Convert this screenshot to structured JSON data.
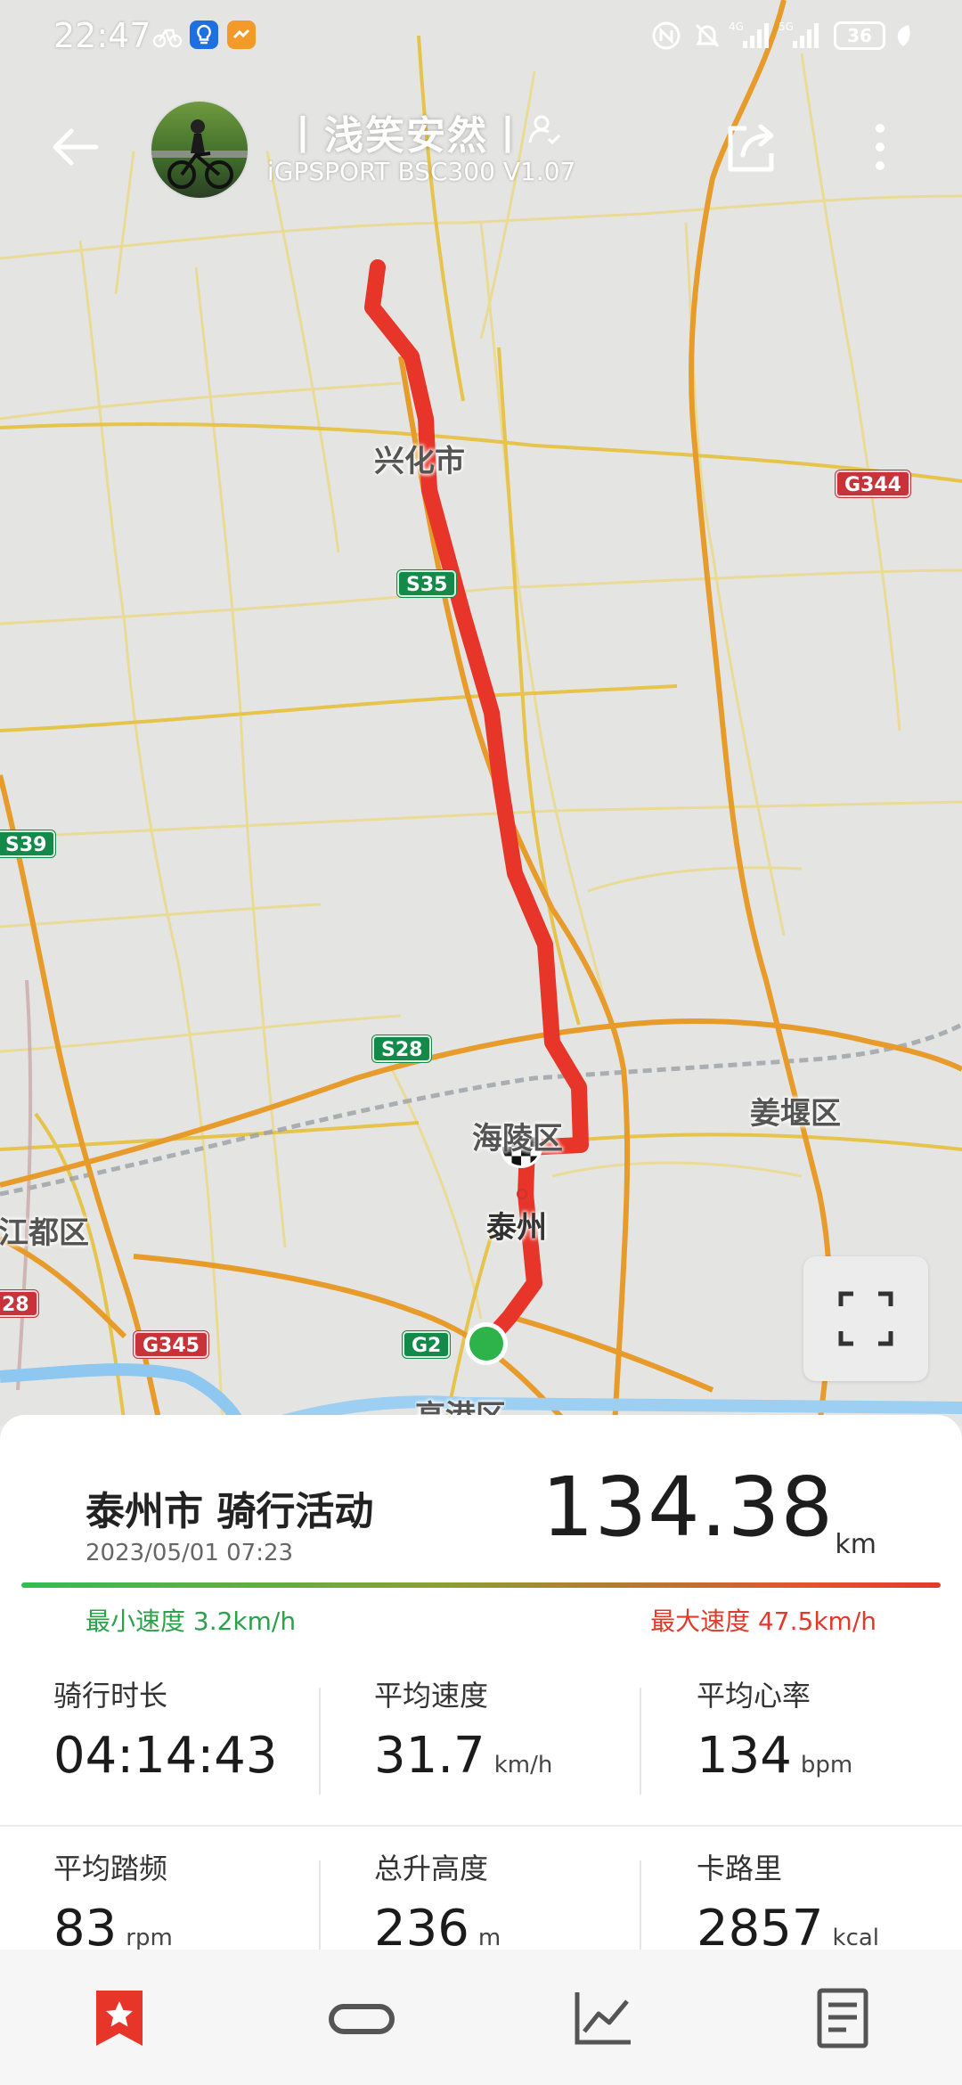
{
  "status_bar": {
    "time": "22:47",
    "battery": "36",
    "icons": [
      "bicycle-notify-icon",
      "lightbulb-app-icon",
      "orange-app-icon",
      "nfc-icon",
      "mute-icon",
      "signal-4g-icon",
      "signal-5g-icon",
      "battery-icon",
      "leaf-icon"
    ]
  },
  "header": {
    "rider_name": "丨浅笑安然丨",
    "device": "iGPSPORT BSC300  V1.07"
  },
  "map": {
    "labels": {
      "xinghua": "兴化市",
      "hailing": "海陵区",
      "taizhou": "泰州",
      "jiangyan": "姜堰区",
      "jiangdu": "江都区",
      "gaogang": "高港区"
    },
    "shields": {
      "s35": "S35",
      "s39": "S39",
      "s28": "S28",
      "g344": "G344",
      "g345": "G345",
      "g2": "G2",
      "left28": "28"
    },
    "route_color": "#e8352a",
    "start_color": "#2db34a"
  },
  "activity": {
    "title": "泰州市 骑行活动",
    "datetime": "2023/05/01 07:23",
    "distance": "134.38",
    "distance_unit": "km",
    "min_speed": "最小速度 3.2km/h",
    "max_speed": "最大速度 47.5km/h"
  },
  "stats": [
    {
      "label": "骑行时长",
      "value": "04:14:43",
      "unit": ""
    },
    {
      "label": "平均速度",
      "value": "31.7",
      "unit": "km/h"
    },
    {
      "label": "平均心率",
      "value": "134",
      "unit": "bpm"
    },
    {
      "label": "平均踏频",
      "value": "83",
      "unit": "rpm"
    },
    {
      "label": "总升高度",
      "value": "236",
      "unit": "m"
    },
    {
      "label": "卡路里",
      "value": "2857",
      "unit": "kcal"
    }
  ],
  "nav": {
    "active_color": "#e8352a",
    "items": [
      "bookmark-star-icon",
      "ride-loop-icon",
      "chart-line-icon",
      "document-list-icon"
    ]
  }
}
